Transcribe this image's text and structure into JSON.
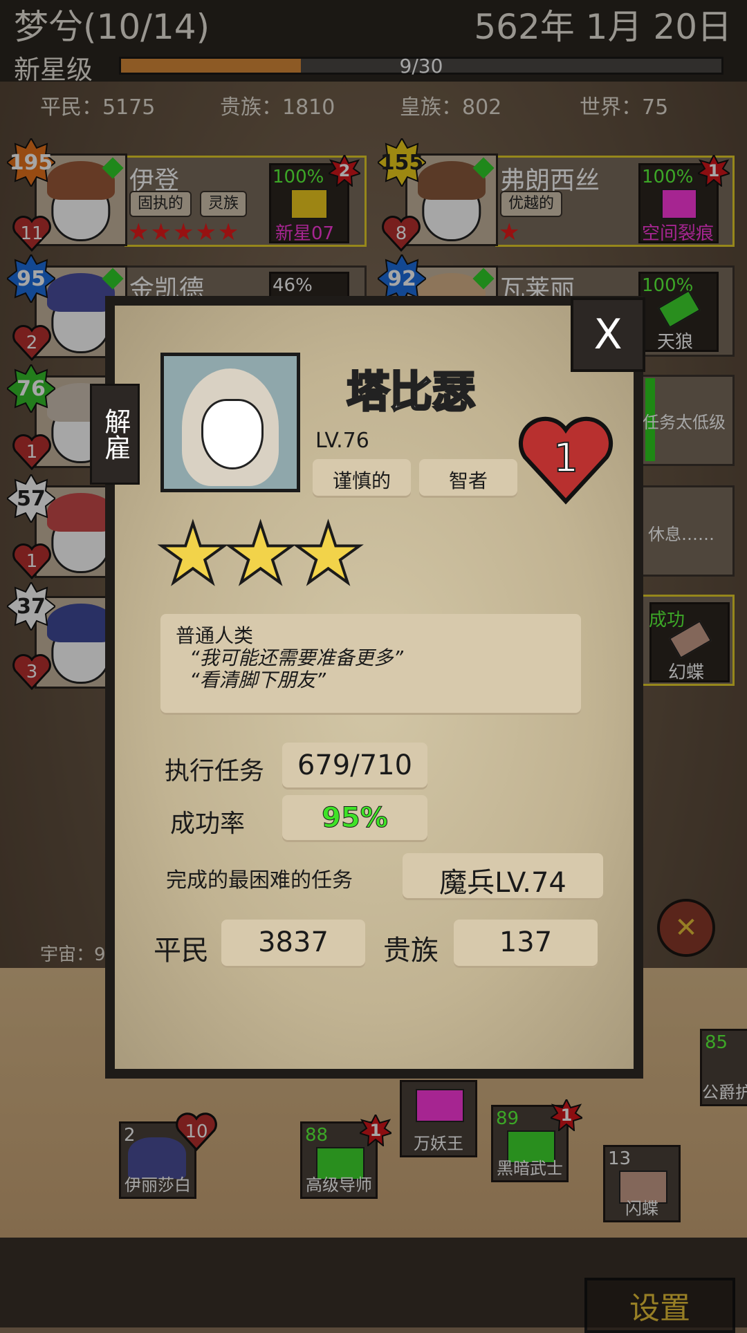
{
  "header": {
    "guild_name": "梦兮(10/14)",
    "date": "562年 1月 20日",
    "rank": "新星级",
    "progress_text": "9/30",
    "progress_fraction": 0.3
  },
  "stats": {
    "commoner": "平民：5175",
    "noble": "贵族：1810",
    "royal": "皇族：802",
    "world": "世界：75"
  },
  "roster": [
    {
      "level": "195",
      "hearts": "11",
      "name": "伊登",
      "traits": [
        "固执的",
        "灵族"
      ],
      "stars": 5,
      "mission_pct": "100%",
      "mission_name": "新星07",
      "mission_count": "2"
    },
    {
      "level": "155",
      "hearts": "8",
      "name": "弗朗西丝",
      "traits": [
        "优越的"
      ],
      "stars": 1,
      "mission_pct": "100%",
      "mission_name": "空间裂痕",
      "mission_count": "1"
    },
    {
      "level": "95",
      "hearts": "2",
      "name": "金凯德",
      "mission_pct": "46%"
    },
    {
      "level": "92",
      "name": "瓦莱丽",
      "mission_pct": "100%",
      "mission_name": "天狼"
    },
    {
      "level": "76",
      "hearts": "1"
    },
    {
      "level": "57",
      "hearts": "1"
    },
    {
      "level": "37",
      "hearts": "3"
    }
  ],
  "right_partial": {
    "row3_text": "任务太低级",
    "row4_text": "休息……",
    "row5_status": "成功",
    "row5_name": "幻蝶"
  },
  "left_partial": {
    "universe": "宇宙：9"
  },
  "modal": {
    "dismiss_label": "解雇",
    "close_label": "X",
    "name": "塔比瑟",
    "level": "LV.76",
    "hearts": "1",
    "traits": [
      "谨慎的",
      "智者"
    ],
    "stars": 3,
    "description": [
      "普通人类",
      "“我可能还需要准备更多”",
      "“看清脚下朋友”"
    ],
    "missions_label": "执行任务",
    "missions_value": "679/710",
    "success_label": "成功率",
    "success_value": "95%",
    "hardest_label": "完成的最困难的任务",
    "hardest_value": "魔兵LV.74",
    "commoner_label": "平民",
    "commoner_value": "3837",
    "noble_label": "贵族",
    "noble_value": "137"
  },
  "floor_items": [
    {
      "name": "伊丽莎白",
      "num": "2",
      "hearts": "10"
    },
    {
      "name": "高级导师",
      "num": "88",
      "badge": "1"
    },
    {
      "name": "万妖王"
    },
    {
      "name": "黑暗武士",
      "num": "89",
      "badge": "1"
    },
    {
      "name": "闪蝶",
      "num": "13"
    },
    {
      "name": "公爵护",
      "num": "85"
    }
  ],
  "settings_label": "设置",
  "colors": {
    "progress": "#d98a3a",
    "success_green": "#5dff3c",
    "mission_pink": "#ff3adf",
    "card_highlight": "#e7cf2a"
  }
}
